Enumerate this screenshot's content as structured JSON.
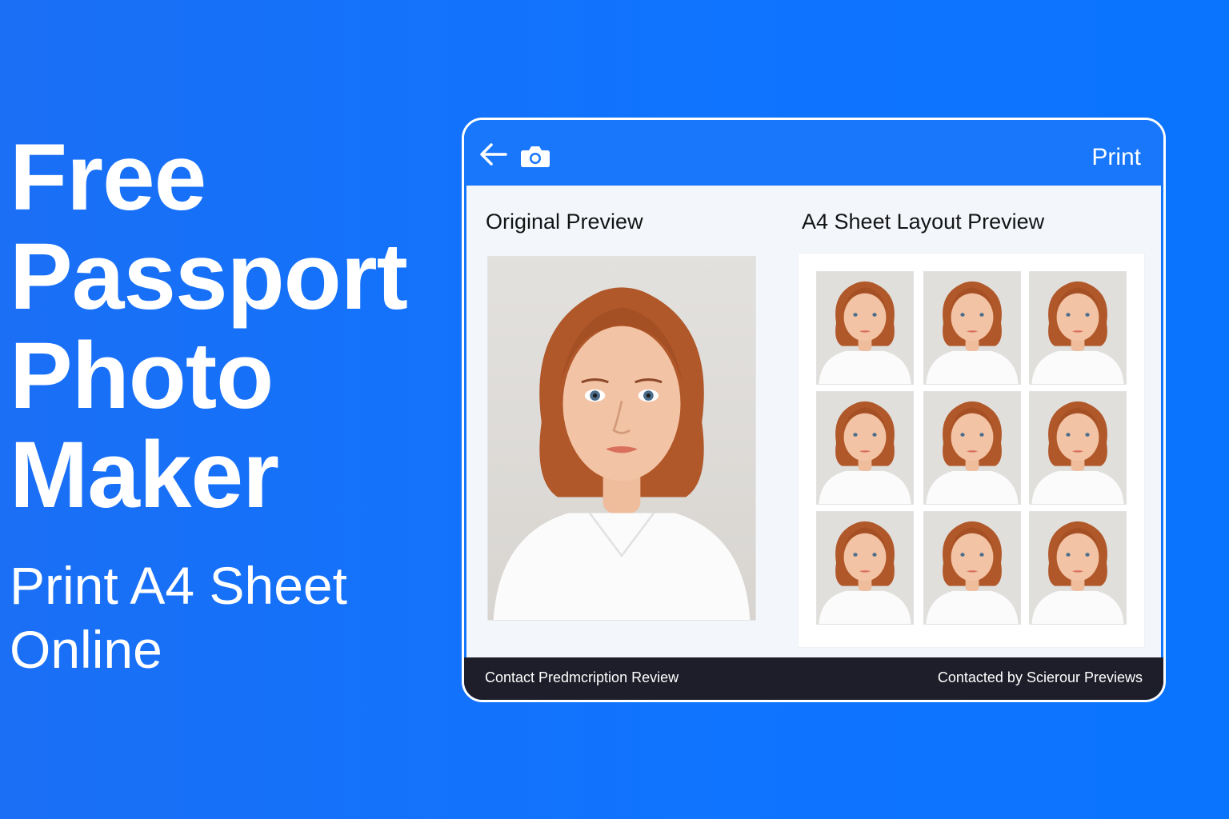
{
  "hero": {
    "title_lines": [
      "Free",
      "Passport",
      "Photo",
      "Maker"
    ],
    "subtitle_lines": [
      "Print A4 Sheet",
      "Online"
    ]
  },
  "app": {
    "toolbar": {
      "back_icon": "arrow-left-icon",
      "camera_icon": "camera-icon",
      "print_label": "Print"
    },
    "original_preview": {
      "title": "Original Preview"
    },
    "sheet_preview": {
      "title": "A4 Sheet Layout Preview",
      "rows": 3,
      "columns": 3
    },
    "footer": {
      "left_text": "Contact Predmcription Review",
      "right_text": "Contacted by Scierour Previews"
    }
  },
  "colors": {
    "background": "#0f74ff",
    "toolbar": "#1877fb",
    "footer": "#1e1e2a",
    "hair": "#b0582a",
    "skin": "#f2c3a4"
  }
}
